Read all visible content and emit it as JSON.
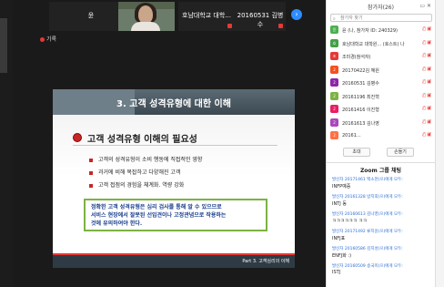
{
  "tiles": [
    {
      "name": "윤"
    },
    {
      "name": ""
    },
    {
      "name": "호남대학교 대학..."
    },
    {
      "name": "20160531 김병수"
    }
  ],
  "recording": "기록",
  "slide": {
    "title": "3. 고객 성격유형에 대한 이해",
    "subtitle": "고객 성격유형 이해의 필요성",
    "bullets": [
      "고객의 성격유형이 소비 행동에 직접적인 영향",
      "과거에 비해 복잡하고 다양해진 고객",
      "고객 접점의 경험을 체계화. 역량 강화"
    ],
    "box_line1": "정확한 고객 성격유형은 심리 검사를 통해 알 수 있으므로",
    "box_line2": "서비스 현장에서 잘못된 선입견이나 고정관념으로 작용하는",
    "box_line3": "것에 유의하여야 한다.",
    "footer": "Part 3. 고객심리의 이해"
  },
  "panel": {
    "title": "참가자(26)",
    "search_placeholder": "참가자 찾기",
    "participants": [
      {
        "initial": "윤",
        "name": "윤 (나, 참가자 ID: 240329)",
        "color": "#4caf50"
      },
      {
        "initial": "호",
        "name": "호남대학교 대학원... (호스트) 나",
        "color": "#43a047"
      },
      {
        "initial": "조",
        "name": "조미경(참석자)",
        "color": "#e53935"
      },
      {
        "initial": "2",
        "name": "20170422김 혜원",
        "color": "#f4511e"
      },
      {
        "initial": "2",
        "name": "20160531 김병수",
        "color": "#8e24aa"
      },
      {
        "initial": "2",
        "name": "20161196 최진혁",
        "color": "#7cb342"
      },
      {
        "initial": "2",
        "name": "20161416 이진형",
        "color": "#e91e63"
      },
      {
        "initial": "2",
        "name": "20161613 김나영",
        "color": "#ab47bc"
      },
      {
        "initial": "2",
        "name": "20161...",
        "color": "#ff7043"
      }
    ],
    "invite": "초대",
    "raise": "손들기"
  },
  "chat": {
    "title": "Zoom 그룹 채팅",
    "messages": [
      {
        "meta": "발신자 20171461 백소현(으)에게 모두:",
        "text": "INFP예증"
      },
      {
        "meta": "발신자 20161328 방지희(으)에게 모두:",
        "text": "INTJ 동"
      },
      {
        "meta": "발신자 20160613 김나영(으)에게 모두:",
        "text": "ㅋㅋㅋㅋㅋㅋ ㅋㅋ"
      },
      {
        "meta": "발신자 20171492 류지윤(으)에게 모두:",
        "text": "INFJ표"
      },
      {
        "meta": "발신자 20160586 김지성(으)에게 모두:",
        "text": "ENFJ화 :)"
      },
      {
        "meta": "발신자 20160509 송국미(으)에게 모두:",
        "text": "ISTJ"
      }
    ]
  }
}
